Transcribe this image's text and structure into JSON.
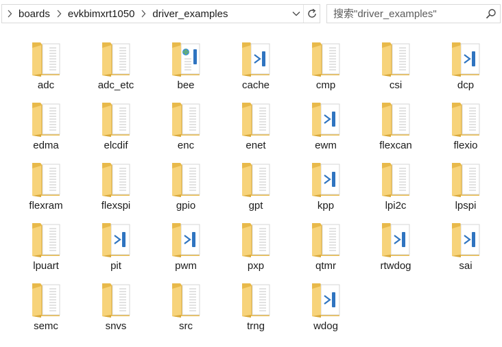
{
  "address_bar": {
    "breadcrumbs": [
      "boards",
      "evkbimxrt1050",
      "driver_examples"
    ]
  },
  "search": {
    "placeholder": "搜索\"driver_examples\""
  },
  "colors": {
    "folder_back": "#e8b94a",
    "folder_front": "#f7d37a",
    "paper": "#ffffff",
    "vs_badge": "#2f74c0"
  },
  "items": [
    {
      "name": "adc",
      "icon": "folder-icon"
    },
    {
      "name": "adc_etc",
      "icon": "folder-icon"
    },
    {
      "name": "bee",
      "icon": "folder-web-icon"
    },
    {
      "name": "cache",
      "icon": "folder-vs-icon"
    },
    {
      "name": "cmp",
      "icon": "folder-icon"
    },
    {
      "name": "csi",
      "icon": "folder-icon"
    },
    {
      "name": "dcp",
      "icon": "folder-vs-icon"
    },
    {
      "name": "edma",
      "icon": "folder-icon"
    },
    {
      "name": "elcdif",
      "icon": "folder-icon"
    },
    {
      "name": "enc",
      "icon": "folder-icon"
    },
    {
      "name": "enet",
      "icon": "folder-icon"
    },
    {
      "name": "ewm",
      "icon": "folder-vs-icon"
    },
    {
      "name": "flexcan",
      "icon": "folder-icon"
    },
    {
      "name": "flexio",
      "icon": "folder-icon"
    },
    {
      "name": "flexram",
      "icon": "folder-icon"
    },
    {
      "name": "flexspi",
      "icon": "folder-icon"
    },
    {
      "name": "gpio",
      "icon": "folder-icon"
    },
    {
      "name": "gpt",
      "icon": "folder-icon"
    },
    {
      "name": "kpp",
      "icon": "folder-vs-icon"
    },
    {
      "name": "lpi2c",
      "icon": "folder-icon"
    },
    {
      "name": "lpspi",
      "icon": "folder-icon"
    },
    {
      "name": "lpuart",
      "icon": "folder-icon"
    },
    {
      "name": "pit",
      "icon": "folder-vs-icon"
    },
    {
      "name": "pwm",
      "icon": "folder-vs-icon"
    },
    {
      "name": "pxp",
      "icon": "folder-icon"
    },
    {
      "name": "qtmr",
      "icon": "folder-icon"
    },
    {
      "name": "rtwdog",
      "icon": "folder-vs-icon"
    },
    {
      "name": "sai",
      "icon": "folder-vs-icon"
    },
    {
      "name": "semc",
      "icon": "folder-icon"
    },
    {
      "name": "snvs",
      "icon": "folder-icon"
    },
    {
      "name": "src",
      "icon": "folder-icon"
    },
    {
      "name": "trng",
      "icon": "folder-icon"
    },
    {
      "name": "wdog",
      "icon": "folder-vs-icon"
    }
  ]
}
